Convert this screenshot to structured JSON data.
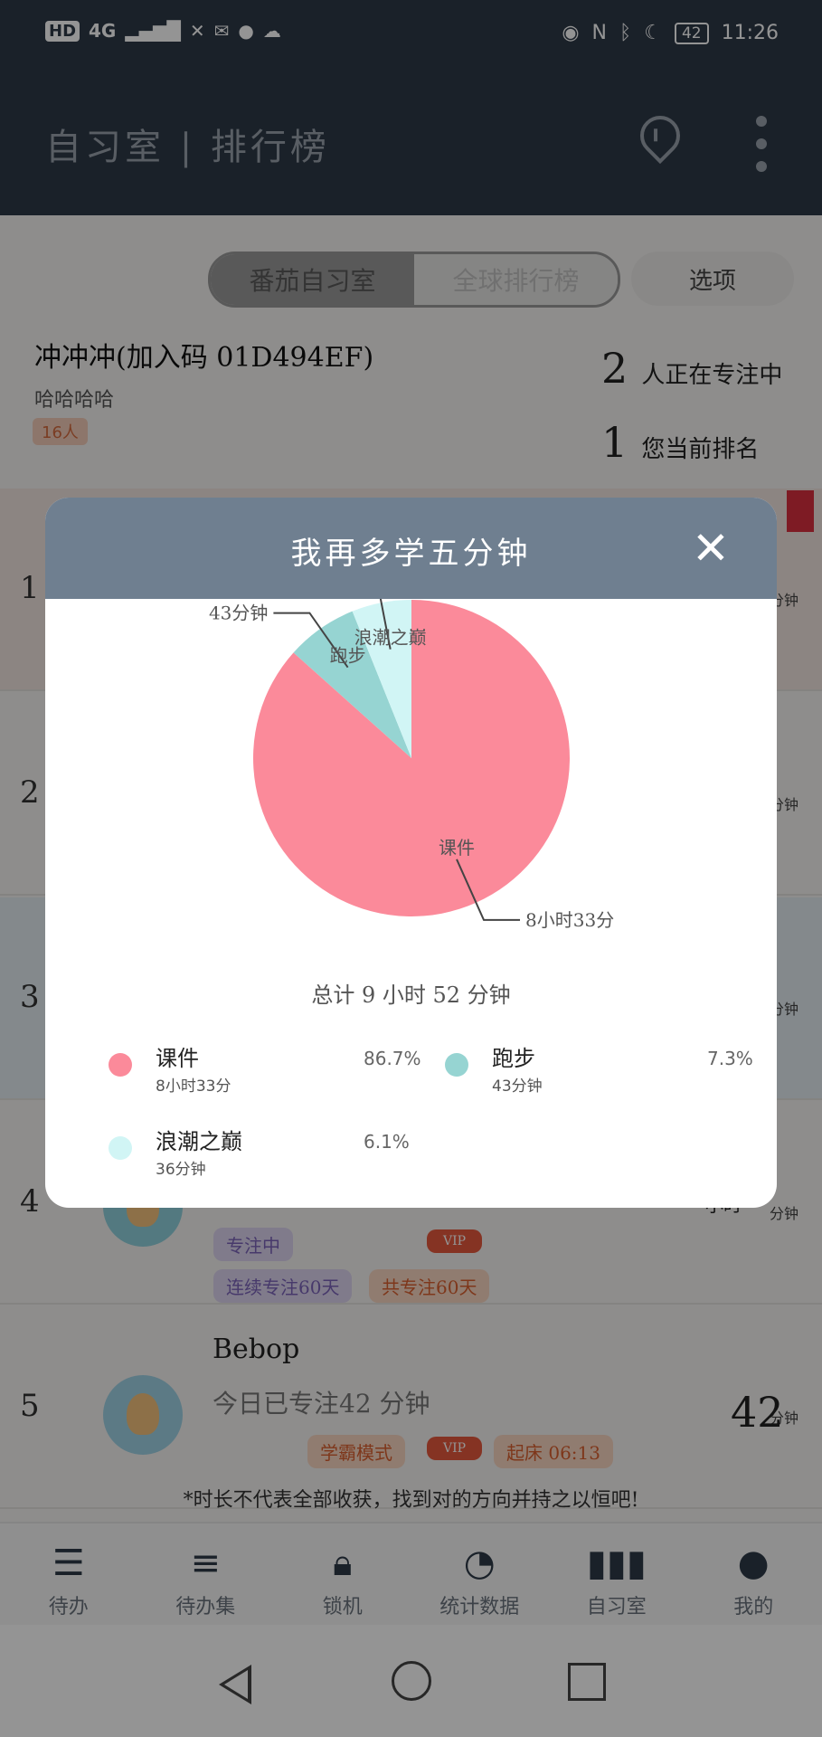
{
  "status_bar": {
    "left": [
      "HD",
      "4G",
      "✕"
    ],
    "time": "11:26",
    "battery": "42"
  },
  "header": {
    "title": "自习室 | 排行榜"
  },
  "tabs": {
    "active": "番茄自习室",
    "inactive": "全球排行榜",
    "options": "选项"
  },
  "room": {
    "name": "冲冲冲(加入码 01D494EF)",
    "subtitle": "哈哈哈哈",
    "members": "16人",
    "focusing_count": "2",
    "focusing_label": "人正在专注中",
    "rank_value": "1",
    "rank_label": "您当前排名"
  },
  "ranks": {
    "r1": "1",
    "r2": "2",
    "r3": "3",
    "r4": "4",
    "r5": "5",
    "unit": "分钟"
  },
  "rank4": {
    "chip1": "专注中",
    "chip2": "VIP",
    "chip3": "连续专注60天",
    "chip4": "共专注60天",
    "score_unit": "小时"
  },
  "rank5": {
    "name": "Bebop",
    "today": "今日已专注42 分钟",
    "score": "42",
    "unit": "分钟",
    "chip1": "学霸模式",
    "chip2": "VIP",
    "chip3": "起床 06:13"
  },
  "footer_note": "*时长不代表全部收获，找到对的方向并持之以恒吧!",
  "bottom_nav": [
    {
      "label": "待办",
      "icon": "todo-icon"
    },
    {
      "label": "待办集",
      "icon": "todo-set-icon"
    },
    {
      "label": "锁机",
      "icon": "lock-icon"
    },
    {
      "label": "统计数据",
      "icon": "pie-chart-icon"
    },
    {
      "label": "自习室",
      "icon": "bar-chart-icon"
    },
    {
      "label": "我的",
      "icon": "user-icon"
    }
  ],
  "modal": {
    "title": "我再多学五分钟",
    "total": "总计 9 小时 52 分钟",
    "legend": [
      {
        "name": "课件",
        "time": "8小时33分",
        "pct": "86.7%",
        "color": "#fb8a9a"
      },
      {
        "name": "跑步",
        "time": "43分钟",
        "pct": "7.3%",
        "color": "#96d4d2"
      },
      {
        "name": "浪潮之巅",
        "time": "36分钟",
        "pct": "6.1%",
        "color": "#d1f5f5"
      }
    ]
  },
  "chart_data": {
    "type": "pie",
    "categories": [
      "课件",
      "跑步",
      "浪潮之巅"
    ],
    "values": [
      86.7,
      7.3,
      6.1
    ],
    "slice_labels": [
      "8小时33分",
      "43分钟",
      "36分钟"
    ],
    "colors": [
      "#fb8a9a",
      "#96d4d2",
      "#d1f5f5"
    ],
    "total_label": "总计 9 小时 52 分钟"
  }
}
